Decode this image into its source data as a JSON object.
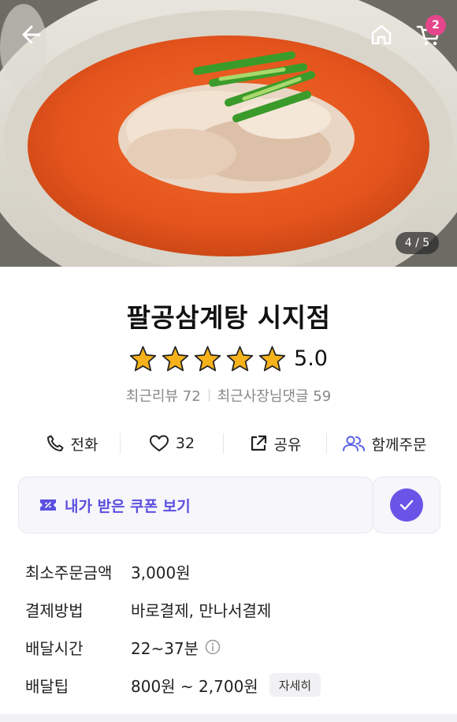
{
  "header": {
    "cart_count": "2",
    "photo_index": "4 / 5"
  },
  "store": {
    "name": "팔공삼계탕 시지점",
    "rating": "5.0",
    "rating_value": 5,
    "reviews_label": "최근리뷰 72",
    "owner_replies_label": "최근사장님댓글 59"
  },
  "actions": {
    "call_label": "전화",
    "like_count": "32",
    "share_label": "공유",
    "group_order_label": "함께주문"
  },
  "coupon": {
    "label": "내가 받은 쿠폰 보기"
  },
  "info": {
    "rows": [
      {
        "label": "최소주문금액",
        "value": "3,000원"
      },
      {
        "label": "결제방법",
        "value": "바로결제, 만나서결제"
      },
      {
        "label": "배달시간",
        "value": "22~37분"
      },
      {
        "label": "배달팁",
        "value": "800원 ~ 2,700원"
      }
    ],
    "detail_button": "자세히"
  },
  "colors": {
    "accent": "#6a54e8",
    "badge": "#e5458a",
    "star": "#f6b21a"
  }
}
